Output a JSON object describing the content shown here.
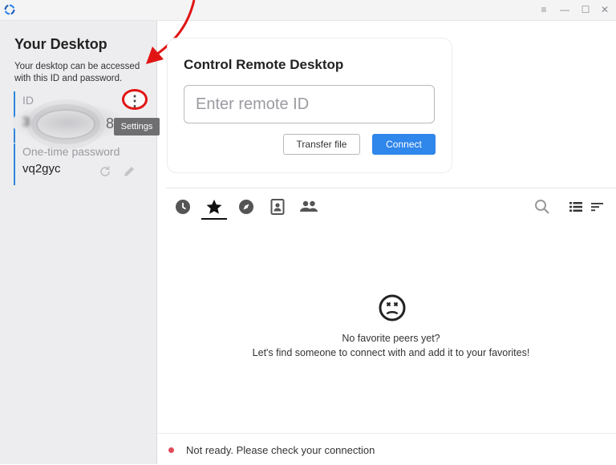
{
  "window": {
    "app_icon": "rustdesk-logo-icon",
    "controls": [
      "menu-icon",
      "minimize-icon",
      "maximize-icon",
      "close-icon"
    ]
  },
  "sidebar": {
    "title": "Your Desktop",
    "description": "Your desktop can be accessed with this ID and password.",
    "id_label": "ID",
    "id_value": "3",
    "id_value_tail": "8",
    "settings_tooltip": "Settings",
    "password_label": "One-time password",
    "password_value": "vq2gyc"
  },
  "remote": {
    "title": "Control Remote Desktop",
    "input_placeholder": "Enter remote ID",
    "input_value": "",
    "transfer_label": "Transfer file",
    "connect_label": "Connect"
  },
  "peers": {
    "tabs": [
      "recent-icon",
      "favorites-icon",
      "discovered-icon",
      "address-book-icon",
      "group-icon"
    ],
    "active_tab": "favorites",
    "empty_line1": "No favorite peers yet?",
    "empty_line2": "Let's find someone to connect with and add it to your favorites!"
  },
  "status": {
    "text": "Not ready. Please check your connection",
    "color": "#e04b5a"
  },
  "colors": {
    "accent": "#2f86eb",
    "annotation": "#e11414"
  }
}
